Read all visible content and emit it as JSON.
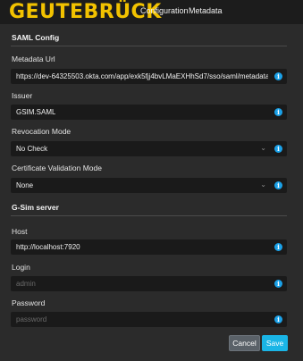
{
  "header": {
    "logo": "GEUTEBRÜCK",
    "nav": [
      "Configuration",
      "Metadata"
    ]
  },
  "saml": {
    "title": "SAML Config",
    "metadata_url": {
      "label": "Metadata Url",
      "value": "https://dev-64325503.okta.com/app/exk5fjj4bvLMaEXHhSd7/sso/saml/metadata"
    },
    "issuer": {
      "label": "Issuer",
      "value": "GSIM.SAML"
    },
    "revocation": {
      "label": "Revocation Mode",
      "value": "No Check"
    },
    "cert_validation": {
      "label": "Certificate Validation Mode",
      "value": "None"
    }
  },
  "gsim": {
    "title": "G-Sim server",
    "host": {
      "label": "Host",
      "value": "http://localhost:7920"
    },
    "login": {
      "label": "Login",
      "placeholder": "admin"
    },
    "password": {
      "label": "Password",
      "placeholder": "password"
    }
  },
  "buttons": {
    "cancel": "Cancel",
    "save": "Save"
  },
  "colors": {
    "brand": "#f2c200",
    "accent": "#1ab5e6",
    "info": "#1aa1e8"
  },
  "icons": {
    "info": "info-icon",
    "dropdown": "chevron-down-icon"
  }
}
